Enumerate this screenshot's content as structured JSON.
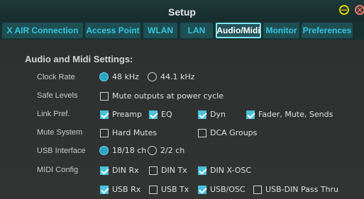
{
  "window": {
    "title": "Setup"
  },
  "tabs": [
    {
      "label": "X AIR Connection",
      "active": false
    },
    {
      "label": "Access Point",
      "active": false
    },
    {
      "label": "WLAN",
      "active": false
    },
    {
      "label": "LAN",
      "active": false
    },
    {
      "label": "Audio/Midi",
      "active": true
    },
    {
      "label": "Monitor",
      "active": false
    },
    {
      "label": "Preferences",
      "active": false
    }
  ],
  "section": {
    "heading": "Audio and Midi Settings:"
  },
  "settings": {
    "clock_rate": {
      "label": "Clock Rate",
      "options": [
        {
          "label": "48 kHz",
          "selected": true
        },
        {
          "label": "44.1 kHz",
          "selected": false
        }
      ]
    },
    "safe_levels": {
      "label": "Safe Levels",
      "options": [
        {
          "label": "Mute outputs at power cycle",
          "checked": false
        }
      ]
    },
    "link_pref": {
      "label": "Link Pref.",
      "options": [
        {
          "label": "Preamp",
          "checked": true
        },
        {
          "label": "EQ",
          "checked": true
        },
        {
          "label": "Dyn",
          "checked": true
        },
        {
          "label": "Fader, Mute, Sends",
          "checked": true
        }
      ]
    },
    "mute_system": {
      "label": "Mute System",
      "options": [
        {
          "label": "Hard Mutes",
          "checked": false
        },
        {
          "label": "DCA Groups",
          "checked": false
        }
      ]
    },
    "usb_interface": {
      "label": "USB Interface",
      "options": [
        {
          "label": "18/18 ch",
          "selected": true
        },
        {
          "label": "2/2 ch",
          "selected": false
        }
      ]
    },
    "midi_config": {
      "label": "MIDI Config",
      "options": [
        {
          "label": "DIN Rx",
          "checked": true
        },
        {
          "label": "DIN Tx",
          "checked": false
        },
        {
          "label": "DIN X-OSC",
          "checked": true
        }
      ]
    },
    "midi_usb": {
      "options": [
        {
          "label": "USB Rx",
          "checked": true
        },
        {
          "label": "USB Tx",
          "checked": false
        },
        {
          "label": "USB/OSC",
          "checked": true
        },
        {
          "label": "USB-DIN Pass Thru",
          "checked": false
        }
      ]
    }
  },
  "colors": {
    "accent": "#49c2dd",
    "tab_text": "#34c6e0",
    "background": "#2f3130",
    "titlebar": "#1f3a3a"
  }
}
